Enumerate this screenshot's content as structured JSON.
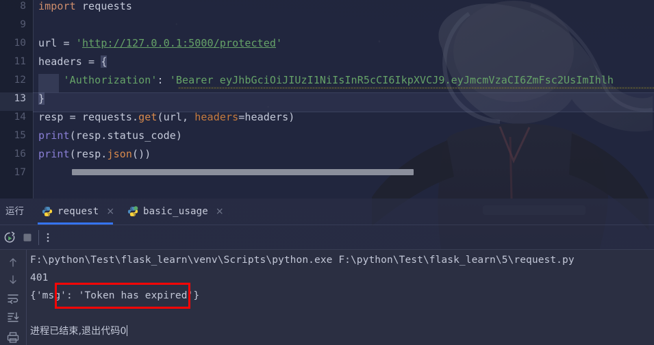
{
  "theme": {
    "editor_bg": "#1c1f2e",
    "console_bg": "#2b2f42",
    "tabbar_bg": "#282d42",
    "accent_blue": "#3574f0",
    "highlight_red": "#fb0606",
    "string_green": "#66a368",
    "keyword_orange": "#cf8e6d",
    "builtin_purple": "#8a7fd6",
    "line_number": "#565c73"
  },
  "editor": {
    "line_numbers": [
      "8",
      "9",
      "10",
      "11",
      "12",
      "13",
      "14",
      "15",
      "16",
      "17"
    ],
    "active_line": "13",
    "lines": [
      {
        "n": "8",
        "tokens": [
          {
            "t": "import",
            "c": "kw"
          },
          {
            "t": " requests",
            "c": "plain"
          }
        ]
      },
      {
        "n": "9",
        "tokens": []
      },
      {
        "n": "10",
        "tokens": [
          {
            "t": "url = ",
            "c": "plain"
          },
          {
            "t": "'",
            "c": "str"
          },
          {
            "t": "http://127.0.0.1:5000/protected",
            "c": "link"
          },
          {
            "t": "'",
            "c": "str"
          }
        ]
      },
      {
        "n": "11",
        "tokens": [
          {
            "t": "headers = ",
            "c": "plain"
          },
          {
            "t": "{",
            "c": "brace-hl"
          }
        ]
      },
      {
        "n": "12",
        "tokens": [
          {
            "t": "    ",
            "c": "plain"
          },
          {
            "t": "'Authorization'",
            "c": "str"
          },
          {
            "t": ": ",
            "c": "plain"
          },
          {
            "t": "'Bearer eyJhbGciOiJIUzI1NiIsInR5cCI6IkpXVCJ9.eyJmcmVzaCI6ZmFsc2UsImIhlh",
            "c": "str"
          }
        ]
      },
      {
        "n": "13",
        "tokens": [
          {
            "t": "}",
            "c": "brace-hl"
          }
        ]
      },
      {
        "n": "14",
        "tokens": [
          {
            "t": "resp = requests.",
            "c": "plain"
          },
          {
            "t": "get",
            "c": "fn"
          },
          {
            "t": "(url, ",
            "c": "plain"
          },
          {
            "t": "headers",
            "c": "kwarg"
          },
          {
            "t": "=headers)",
            "c": "plain"
          }
        ]
      },
      {
        "n": "15",
        "tokens": [
          {
            "t": "print",
            "c": "builtin"
          },
          {
            "t": "(resp.status_code)",
            "c": "plain"
          }
        ]
      },
      {
        "n": "16",
        "tokens": [
          {
            "t": "print",
            "c": "builtin"
          },
          {
            "t": "(resp.",
            "c": "plain"
          },
          {
            "t": "json",
            "c": "fn"
          },
          {
            "t": "())",
            "c": "plain"
          }
        ]
      },
      {
        "n": "17",
        "tokens": []
      }
    ]
  },
  "run_window": {
    "title": "运行",
    "tabs": [
      {
        "label": "request",
        "icon": "python-file-icon",
        "close": "×",
        "active": true,
        "running": false
      },
      {
        "label": "basic_usage",
        "icon": "python-file-icon",
        "close": "×",
        "active": false,
        "running": true
      }
    ],
    "toolbar": [
      {
        "name": "rerun-button",
        "title": "Rerun"
      },
      {
        "name": "stop-button",
        "title": "Stop"
      },
      {
        "name": "more-options-button",
        "title": "More"
      }
    ],
    "side_actions": [
      {
        "name": "up-arrow-icon",
        "title": "Previous Occurrence"
      },
      {
        "name": "down-arrow-icon",
        "title": "Next Occurrence"
      },
      {
        "name": "soft-wrap-icon",
        "title": "Soft-Wrap"
      },
      {
        "name": "scroll-to-end-icon",
        "title": "Scroll to End"
      },
      {
        "name": "print-icon",
        "title": "Print"
      }
    ],
    "console": {
      "command_line": "F:\\python\\Test\\flask_learn\\venv\\Scripts\\python.exe F:\\python\\Test\\flask_learn\\5\\request.py",
      "status_code": "401",
      "response_prefix": "{'msg': ",
      "response_highlight": "'Token has expired'",
      "response_suffix": "}",
      "exit_message": "进程已结束,退出代码0"
    }
  }
}
